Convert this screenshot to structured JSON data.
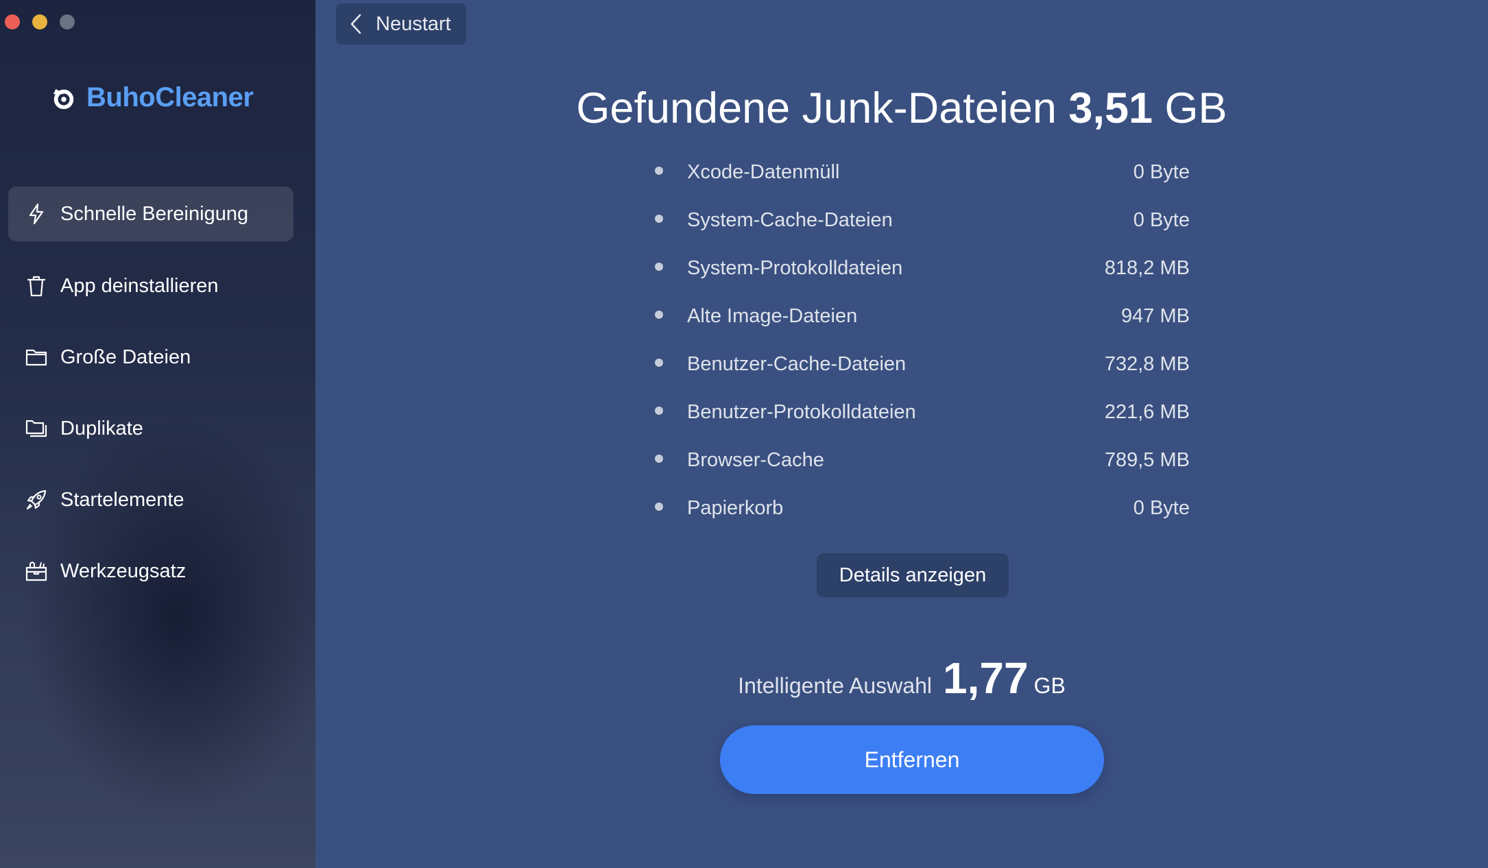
{
  "window": {
    "traffic_lights": [
      "close",
      "minimize",
      "maximize"
    ]
  },
  "sidebar": {
    "brand": {
      "name": "BuhoCleaner",
      "color": "#5a9ff5"
    },
    "items": [
      {
        "label": "Schnelle Bereinigung",
        "icon": "lightning-icon",
        "active": true
      },
      {
        "label": "App deinstallieren",
        "icon": "trash-icon",
        "active": false
      },
      {
        "label": "Große Dateien",
        "icon": "folder-icon",
        "active": false
      },
      {
        "label": "Duplikate",
        "icon": "duplicate-folder-icon",
        "active": false
      },
      {
        "label": "Startelemente",
        "icon": "rocket-icon",
        "active": false
      },
      {
        "label": "Werkzeugsatz",
        "icon": "toolbox-icon",
        "active": false
      }
    ]
  },
  "main": {
    "back_label": "Neustart",
    "headline": {
      "text": "Gefundene Junk-Dateien",
      "value": "3,51",
      "unit": "GB"
    },
    "junk_items": [
      {
        "name": "Xcode-Datenmüll",
        "size": "0 Byte"
      },
      {
        "name": "System-Cache-Dateien",
        "size": "0 Byte"
      },
      {
        "name": "System-Protokolldateien",
        "size": "818,2 MB"
      },
      {
        "name": "Alte Image-Dateien",
        "size": "947 MB"
      },
      {
        "name": "Benutzer-Cache-Dateien",
        "size": "732,8 MB"
      },
      {
        "name": "Benutzer-Protokolldateien",
        "size": "221,6 MB"
      },
      {
        "name": "Browser-Cache",
        "size": "789,5 MB"
      },
      {
        "name": "Papierkorb",
        "size": "0 Byte"
      }
    ],
    "details_label": "Details anzeigen",
    "smart_selection": {
      "label": "Intelligente Auswahl",
      "value": "1,77",
      "unit": "GB"
    },
    "remove_label": "Entfernen"
  },
  "colors": {
    "accent": "#3d7ef5",
    "background": "#3a5080"
  }
}
